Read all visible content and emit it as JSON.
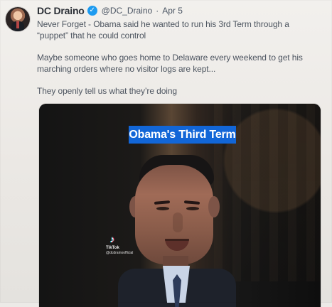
{
  "post": {
    "display_name": "DC Draino",
    "handle": "@DC_Draino",
    "separator": "·",
    "date": "Apr 5",
    "text": {
      "line1": "Never Forget - Obama said he wanted to run his 3rd Term through a",
      "line2": "“puppet” that he could control",
      "line3": "Maybe someone who goes home to Delaware every weekend to get his",
      "line4": "marching orders where no visitor logs are kept...",
      "line5": "They openly tell us what they’re doing"
    }
  },
  "media": {
    "title_overlay": "Obama's Third Term",
    "watermark": {
      "brand": "TikTok",
      "handle": "@dcdrainoofficial"
    }
  },
  "icons": {
    "verified": "verified-icon",
    "tiktok": "tiktok-icon"
  },
  "colors": {
    "verified_blue": "#1d9bf0",
    "title_box_blue": "#1266d7",
    "background": "#eceae7"
  }
}
